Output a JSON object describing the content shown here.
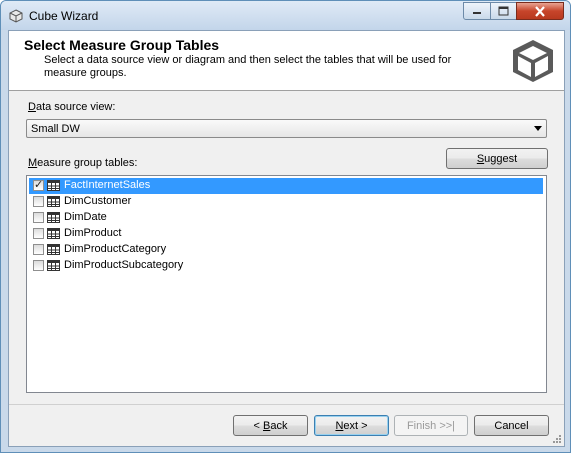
{
  "window": {
    "title": "Cube Wizard"
  },
  "header": {
    "title": "Select Measure Group Tables",
    "description": "Select a data source view or diagram and then select the tables that will be used for measure groups."
  },
  "data_source_view": {
    "label_access": "D",
    "label_rest": "ata source view:",
    "selected": "Small DW"
  },
  "measure_group_tables": {
    "label_access": "M",
    "label_rest": "easure group tables:",
    "suggest_access": "S",
    "suggest_rest": "uggest",
    "items": [
      {
        "label": "FactInternetSales",
        "checked": true,
        "selected": true
      },
      {
        "label": "DimCustomer",
        "checked": false,
        "selected": false
      },
      {
        "label": "DimDate",
        "checked": false,
        "selected": false
      },
      {
        "label": "DimProduct",
        "checked": false,
        "selected": false
      },
      {
        "label": "DimProductCategory",
        "checked": false,
        "selected": false
      },
      {
        "label": "DimProductSubcategory",
        "checked": false,
        "selected": false
      }
    ]
  },
  "buttons": {
    "back_prefix": "< ",
    "back_access": "B",
    "back_rest": "ack",
    "next_access": "N",
    "next_rest": "ext >",
    "finish": "Finish >>|",
    "cancel": "Cancel"
  },
  "colors": {
    "selection": "#3399ff",
    "title_bar": "#c9d9ea",
    "close_button": "#c7452b"
  },
  "icons": [
    "cube-wizard-icon",
    "minimize-icon",
    "maximize-icon",
    "close-icon",
    "cube-logo-icon",
    "dropdown-arrow-icon",
    "table-icon",
    "checkbox-icon",
    "resize-grip-icon"
  ]
}
